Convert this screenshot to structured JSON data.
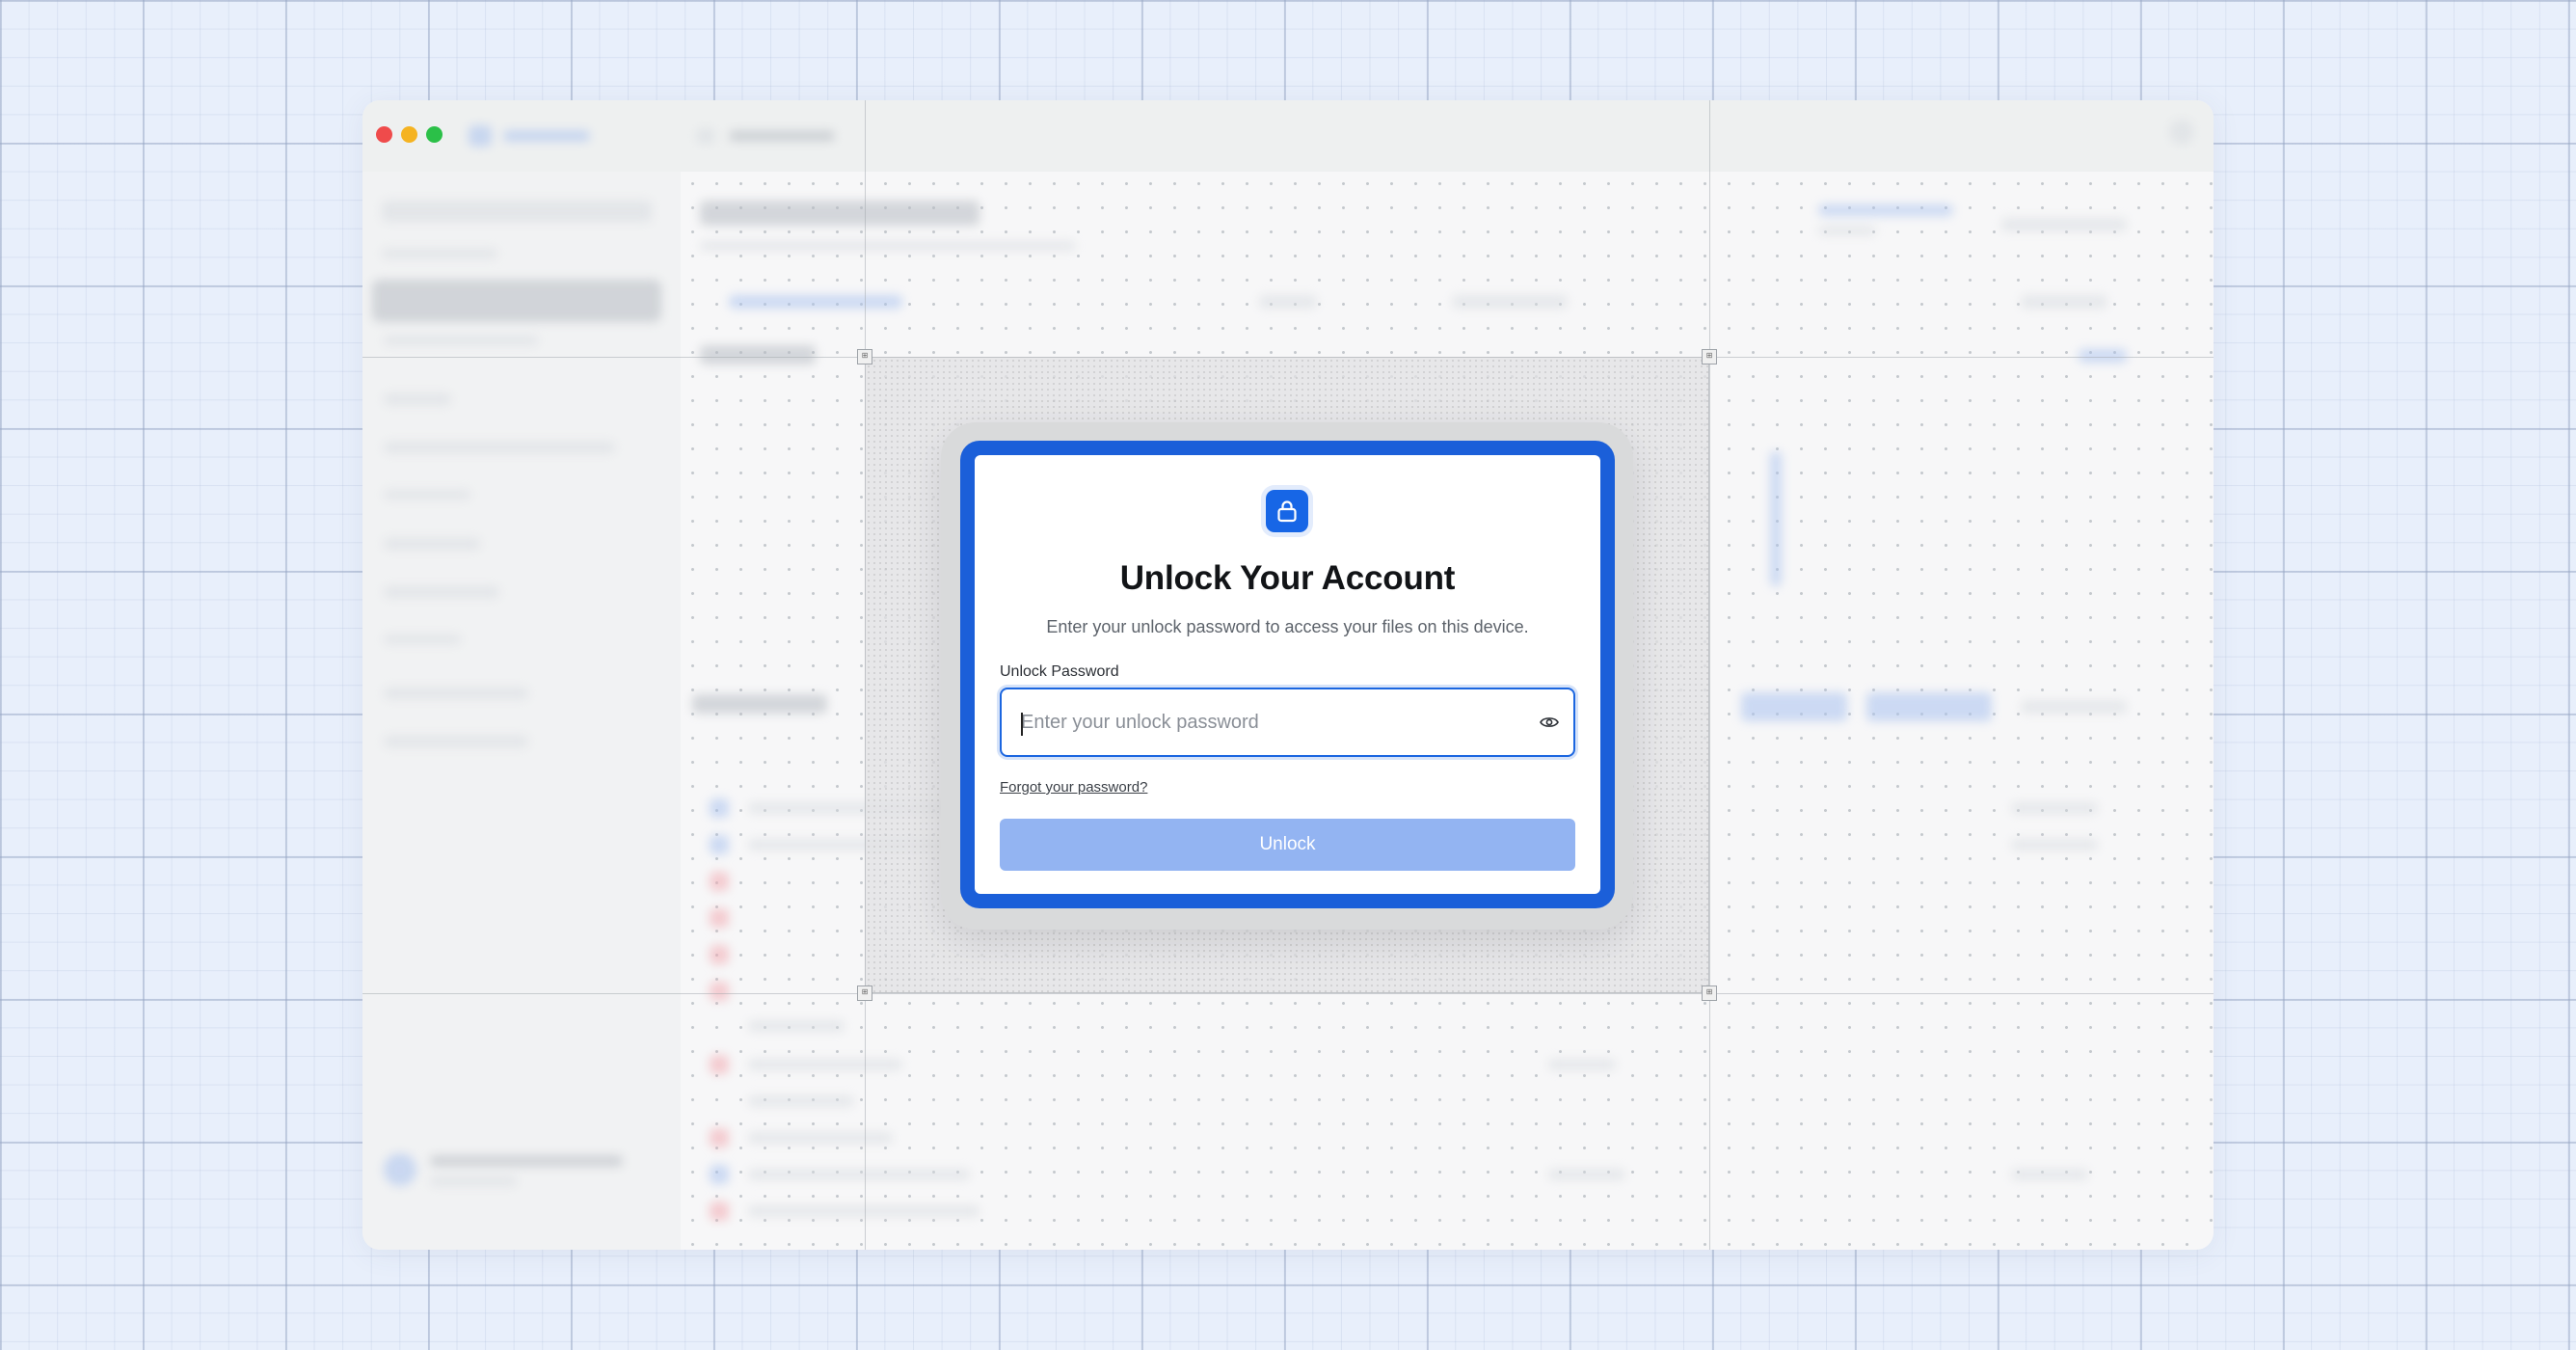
{
  "dialog": {
    "title": "Unlock Your Account",
    "subtitle": "Enter your unlock password to access your files on this device.",
    "password_label": "Unlock Password",
    "password_placeholder": "Enter your unlock password",
    "password_value": "",
    "forgot_link": "Forgot your password?",
    "unlock_button": "Unlock",
    "unlock_enabled": false
  },
  "icons": {
    "lock": "lock-icon",
    "show_password": "eye-icon"
  },
  "colors": {
    "accent": "#1b66e0",
    "dialog_frame": "#1b5fd9",
    "button_disabled": "#93b4f2",
    "traffic_close": "#ef4b4b",
    "traffic_minimize": "#f5b321",
    "traffic_zoom": "#2bc048"
  }
}
